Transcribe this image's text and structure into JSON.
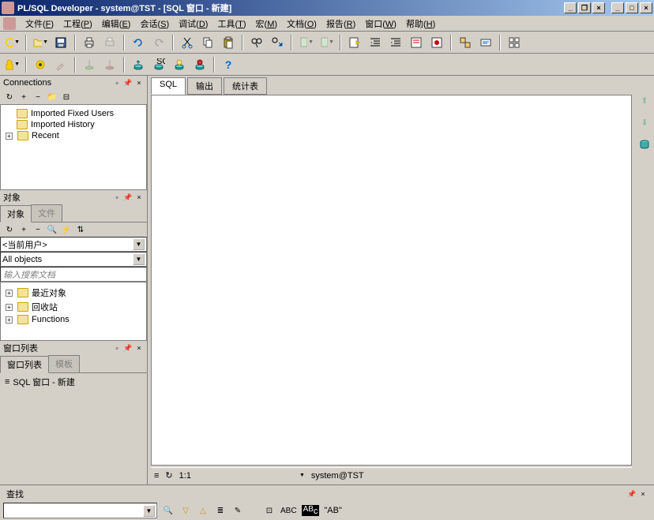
{
  "title": "PL/SQL Developer - system@TST - [SQL 窗口 - 新建]",
  "winbtns": {
    "min": "_",
    "max": "□",
    "close": "×",
    "dmin": "_",
    "drest": "❐",
    "dclose": "×"
  },
  "menus": [
    {
      "label": "文件",
      "key": "F"
    },
    {
      "label": "工程",
      "key": "P"
    },
    {
      "label": "编辑",
      "key": "E"
    },
    {
      "label": "会话",
      "key": "S"
    },
    {
      "label": "调试",
      "key": "D"
    },
    {
      "label": "工具",
      "key": "T"
    },
    {
      "label": "宏",
      "key": "M"
    },
    {
      "label": "文档",
      "key": "O"
    },
    {
      "label": "报告",
      "key": "R"
    },
    {
      "label": "窗口",
      "key": "W"
    },
    {
      "label": "帮助",
      "key": "H"
    }
  ],
  "panels": {
    "connections": {
      "title": "Connections",
      "items": [
        {
          "label": "Imported Fixed Users",
          "expander": ""
        },
        {
          "label": "Imported History",
          "expander": ""
        },
        {
          "label": "Recent",
          "expander": "+"
        }
      ]
    },
    "objects": {
      "title": "对象",
      "tab1": "对象",
      "tab2": "文件",
      "user_combo": "<当前用户>",
      "type_combo": "All objects",
      "search_placeholder": "输入搜索文档",
      "tree": [
        {
          "label": "最近对象",
          "expander": "+"
        },
        {
          "label": "回收站",
          "expander": "+"
        },
        {
          "label": "Functions",
          "expander": "+"
        }
      ]
    },
    "windowlist": {
      "title": "窗口列表",
      "tab1": "窗口列表",
      "tab2": "模板",
      "items": [
        {
          "label": "SQL 窗口 - 新建"
        }
      ]
    }
  },
  "doctabs": [
    "SQL",
    "输出",
    "统计表"
  ],
  "status": {
    "cursor": "1:1",
    "connection": "system@TST"
  },
  "search": {
    "title": "查找",
    "ab_label": "\"AB\""
  },
  "editor_content": ""
}
